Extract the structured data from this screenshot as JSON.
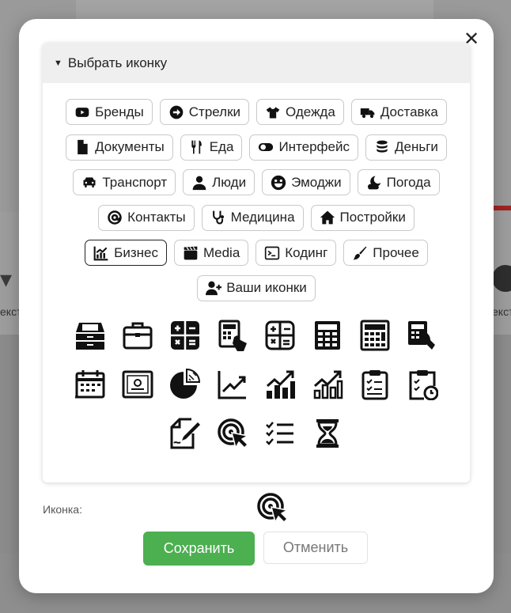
{
  "modal": {
    "close_label": "✕",
    "picker_summary": "Выбрать иконку",
    "categories": [
      {
        "label": "Бренды",
        "icon": "youtube-icon"
      },
      {
        "label": "Стрелки",
        "icon": "arrow-circle-icon"
      },
      {
        "label": "Одежда",
        "icon": "tshirt-icon"
      },
      {
        "label": "Доставка",
        "icon": "truck-icon"
      },
      {
        "label": "Документы",
        "icon": "file-icon"
      },
      {
        "label": "Еда",
        "icon": "utensils-icon"
      },
      {
        "label": "Интерфейс",
        "icon": "toggle-icon"
      },
      {
        "label": "Деньги",
        "icon": "coins-icon"
      },
      {
        "label": "Транспорт",
        "icon": "car-icon"
      },
      {
        "label": "Люди",
        "icon": "user-icon"
      },
      {
        "label": "Эмоджи",
        "icon": "smile-icon"
      },
      {
        "label": "Погода",
        "icon": "cloud-moon-icon"
      },
      {
        "label": "Контакты",
        "icon": "at-icon"
      },
      {
        "label": "Медицина",
        "icon": "stethoscope-icon"
      },
      {
        "label": "Постройки",
        "icon": "house-icon"
      },
      {
        "label": "Бизнес",
        "icon": "chart-line-icon",
        "active": true
      },
      {
        "label": "Media",
        "icon": "clapperboard-icon"
      },
      {
        "label": "Кодинг",
        "icon": "terminal-icon"
      },
      {
        "label": "Прочее",
        "icon": "brush-icon"
      },
      {
        "label": "Ваши иконки",
        "icon": "user-plus-icon"
      }
    ],
    "business_icons": [
      "inbox-tray-icon",
      "briefcase-icon",
      "calculator-icon",
      "calculator-hand-icon",
      "calculator-outline-icon",
      "calculator-keypad-icon",
      "calculator-grid-icon",
      "calculator-touch-icon",
      "calendar-icon",
      "certificate-icon",
      "pie-chart-icon",
      "line-chart-icon",
      "bar-chart-growth-icon",
      "bar-chart-outline-icon",
      "clipboard-check-icon",
      "clipboard-clock-icon",
      "signature-icon",
      "target-cursor-icon",
      "list-check-icon",
      "hourglass-icon"
    ],
    "icon_field_label": "Иконка:",
    "selected_icon": "target-cursor-icon",
    "save_label": "Сохранить",
    "cancel_label": "Отменить"
  },
  "background": {
    "left_text": "екст",
    "right_text": "екст"
  },
  "colors": {
    "save_button": "#4caf50",
    "icon_color": "#111111"
  }
}
